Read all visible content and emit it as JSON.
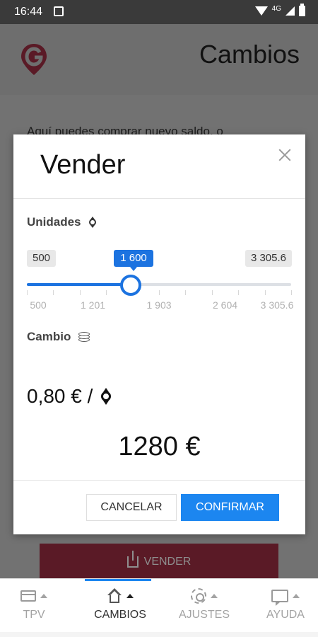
{
  "status_bar": {
    "time": "16:44",
    "network": "4G"
  },
  "app": {
    "title": "Cambios",
    "intro_text": "Aquí puedes comprar nuevo saldo, o",
    "vender_button": "VENDER",
    "brand_color": "#8b1a2b"
  },
  "dialog": {
    "title": "Vender",
    "units_label": "Unidades",
    "slider": {
      "min_label": "500",
      "max_label": "3 305.6",
      "current_label": "1 600",
      "min": 500,
      "max": 3305.6,
      "value": 1600,
      "scale_labels": [
        "500",
        "1 201",
        "1 903",
        "2 604",
        "3 305.6"
      ]
    },
    "exchange_label": "Cambio",
    "rate_text": "0,80 € /",
    "total": "1280 €",
    "cancel_label": "CANCELAR",
    "confirm_label": "CONFIRMAR",
    "accent_color": "#1c73e0"
  },
  "bottom_nav": {
    "items": [
      {
        "label": "TPV",
        "icon": "card-icon",
        "active": false
      },
      {
        "label": "CAMBIOS",
        "icon": "home-icon",
        "active": true
      },
      {
        "label": "AJUSTES",
        "icon": "gear-icon",
        "active": false
      },
      {
        "label": "AYUDA",
        "icon": "chat-icon",
        "active": false
      }
    ]
  }
}
